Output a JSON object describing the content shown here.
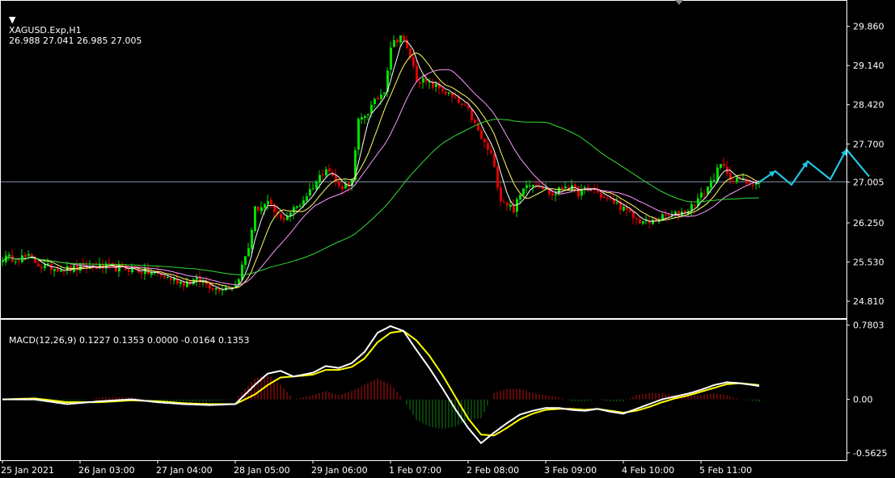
{
  "header": {
    "symbol": "XAGUSD.Exp,H1",
    "ohlc": "26.988 27.041 26.985 27.005",
    "macd_label": "MACD(12,26,9) 0.1227 0.1353 0.0000 -0.0164 0.1353"
  },
  "colors": {
    "background": "#000000",
    "axis": "#ffffff",
    "bull": "#00e000",
    "bear": "#e00000",
    "ma_fast": "#ffffff",
    "ma_yellow": "#ffff66",
    "ma_magenta": "#ff99ff",
    "ma_green": "#33dd33",
    "macd_line": "#ffffff",
    "signal_line": "#ffff00",
    "hist_pos": "#c01010",
    "hist_neg": "#108010",
    "forecast": "#22c8e0",
    "current_line": "#8899aa"
  },
  "chart_data": [
    {
      "type": "candlestick",
      "name": "price",
      "current_price": 27.005,
      "current_price_label": "27.005",
      "ylim": [
        24.5,
        30.3
      ],
      "y_ticks": [
        29.86,
        29.14,
        28.42,
        27.7,
        27.0,
        26.25,
        25.53,
        24.81
      ],
      "y_tick_labels": [
        "29.860",
        "29.140",
        "28.420",
        "27.700",
        "27.005",
        "26.250",
        "25.530",
        "24.810"
      ],
      "x_tick_labels": [
        "25 Jan 2021",
        "26 Jan 03:00",
        "27 Jan 04:00",
        "28 Jan 05:00",
        "29 Jan 06:00",
        "1 Feb 07:00",
        "2 Feb 08:00",
        "3 Feb 09:00",
        "4 Feb 10:00",
        "5 Feb 11:00"
      ],
      "x_tick_index": [
        0,
        24,
        48,
        72,
        96,
        120,
        144,
        168,
        192,
        216
      ],
      "close_path": {
        "index": [
          0,
          8,
          12,
          20,
          28,
          40,
          48,
          56,
          60,
          66,
          72,
          76,
          78,
          82,
          86,
          88,
          92,
          98,
          100,
          104,
          108,
          110,
          113,
          118,
          120,
          123,
          126,
          128,
          132,
          136,
          140,
          144,
          148,
          151,
          154,
          158,
          162,
          166,
          170,
          174,
          178,
          182,
          186,
          190,
          196,
          200,
          204,
          208,
          212,
          216,
          219,
          222,
          224,
          226,
          228,
          230,
          234
        ],
        "close": [
          25.6,
          25.62,
          25.45,
          25.4,
          25.45,
          25.4,
          25.3,
          25.15,
          25.2,
          25.05,
          25.1,
          25.8,
          26.5,
          26.6,
          26.3,
          26.4,
          26.6,
          27.1,
          27.3,
          26.9,
          27.0,
          28.1,
          28.3,
          28.7,
          29.5,
          29.7,
          29.3,
          28.9,
          28.8,
          28.7,
          28.5,
          28.3,
          27.8,
          27.5,
          26.7,
          26.5,
          27.0,
          26.95,
          26.75,
          26.95,
          26.8,
          26.9,
          26.7,
          26.6,
          26.3,
          26.25,
          26.35,
          26.4,
          26.5,
          26.75,
          27.0,
          27.3,
          27.2,
          27.0,
          27.05,
          27.0,
          27.0
        ]
      },
      "moving_averages": [
        {
          "type": "ma",
          "period": 5,
          "color": "#ffffff"
        },
        {
          "type": "ma",
          "period": 10,
          "color": "#ffff66"
        },
        {
          "type": "ma",
          "period": 20,
          "color": "#ff99ff"
        },
        {
          "type": "ma",
          "period": 60,
          "color": "#33dd33"
        }
      ],
      "forecast": {
        "index": [
          234,
          239,
          244,
          249,
          256,
          261,
          268
        ],
        "price": [
          27.0,
          27.2,
          26.95,
          27.38,
          27.05,
          27.6,
          27.1
        ]
      },
      "grid": false
    },
    {
      "type": "macd",
      "name": "MACD(12,26,9)",
      "ylim": [
        -0.64,
        0.82
      ],
      "y_ticks": [
        0.7803,
        0.0,
        -0.5625
      ],
      "y_tick_labels": [
        "0.7803",
        "0.00",
        "-0.5625"
      ],
      "macd": {
        "index": [
          0,
          10,
          20,
          30,
          40,
          48,
          56,
          64,
          72,
          78,
          82,
          86,
          90,
          96,
          100,
          104,
          108,
          112,
          116,
          120,
          124,
          128,
          132,
          136,
          140,
          144,
          148,
          152,
          156,
          160,
          164,
          168,
          172,
          176,
          180,
          184,
          188,
          192,
          196,
          200,
          204,
          208,
          212,
          216,
          220,
          224,
          228,
          234
        ],
        "value": [
          0.0,
          0.0,
          -0.05,
          -0.02,
          0.0,
          -0.03,
          -0.05,
          -0.06,
          -0.05,
          0.15,
          0.27,
          0.3,
          0.24,
          0.28,
          0.35,
          0.33,
          0.38,
          0.5,
          0.7,
          0.77,
          0.72,
          0.52,
          0.33,
          0.12,
          -0.1,
          -0.3,
          -0.46,
          -0.35,
          -0.25,
          -0.16,
          -0.12,
          -0.09,
          -0.09,
          -0.11,
          -0.12,
          -0.1,
          -0.13,
          -0.15,
          -0.1,
          -0.05,
          0.0,
          0.03,
          0.06,
          0.1,
          0.15,
          0.18,
          0.17,
          0.14
        ]
      },
      "signal": {
        "index": [
          0,
          10,
          20,
          30,
          40,
          48,
          56,
          64,
          72,
          78,
          82,
          86,
          90,
          96,
          100,
          104,
          108,
          112,
          116,
          120,
          124,
          128,
          132,
          136,
          140,
          144,
          148,
          152,
          156,
          160,
          164,
          168,
          172,
          176,
          180,
          184,
          188,
          192,
          196,
          200,
          204,
          208,
          212,
          216,
          220,
          224,
          228,
          234
        ],
        "value": [
          0.0,
          0.01,
          -0.03,
          -0.03,
          -0.01,
          -0.02,
          -0.04,
          -0.05,
          -0.05,
          0.05,
          0.15,
          0.23,
          0.24,
          0.26,
          0.31,
          0.31,
          0.34,
          0.43,
          0.6,
          0.7,
          0.72,
          0.62,
          0.46,
          0.26,
          0.03,
          -0.2,
          -0.37,
          -0.38,
          -0.3,
          -0.21,
          -0.15,
          -0.11,
          -0.1,
          -0.1,
          -0.11,
          -0.1,
          -0.12,
          -0.14,
          -0.12,
          -0.08,
          -0.03,
          0.01,
          0.04,
          0.08,
          0.12,
          0.16,
          0.17,
          0.15
        ]
      }
    }
  ]
}
